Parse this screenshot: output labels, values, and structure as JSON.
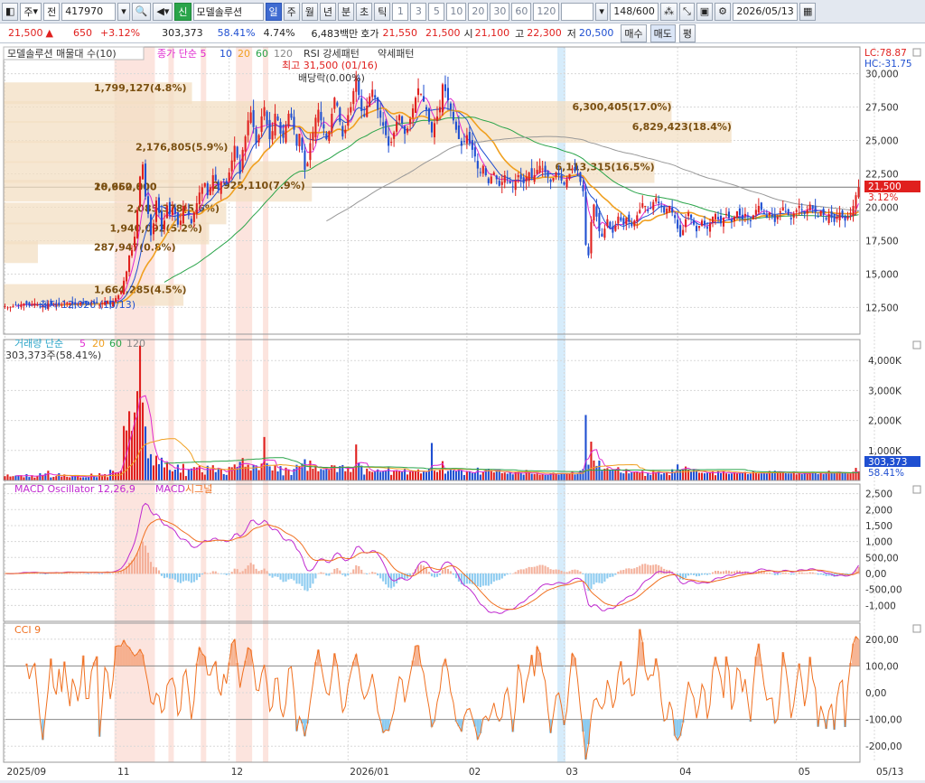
{
  "toolbar": {
    "market": "주",
    "prev": "전",
    "code": "417970",
    "badge": "신",
    "name": "모델솔루션",
    "period_tabs": [
      "일",
      "주",
      "월",
      "년",
      "분",
      "초",
      "틱"
    ],
    "active_tab": "일",
    "intervals": [
      "1",
      "3",
      "5",
      "10",
      "20",
      "30",
      "60",
      "120"
    ],
    "count": "148/600",
    "date": "2026/05/13"
  },
  "info": {
    "price": "21,500",
    "change": "650",
    "change_pct": "+3.12%",
    "volume": "303,373",
    "vol_ratio": "58.41%",
    "turnover": "4.74%",
    "amount": "6,483백만",
    "quote_label": "호가",
    "ask": "21,550",
    "bid": "21,500",
    "open_label": "시",
    "open": "21,100",
    "high_label": "고",
    "high": "22,300",
    "low_label": "저",
    "low": "20,500",
    "buy_btn": "매수",
    "sell_btn": "매도",
    "flat_btn": "평"
  },
  "chart_data": {
    "type": "candlestick",
    "price_panel": {
      "legend_name": "모델솔루션 매물대 수(10)",
      "legend_ma": [
        "종가 단순 5",
        "10",
        "20",
        "60",
        "120"
      ],
      "legend_rsi": "RSI 강세패턴",
      "legend_rsi2": "약세패턴",
      "lc": "LC:78.87",
      "hc": "HC:-31.75",
      "y_ticks": [
        "30,000",
        "27,500",
        "25,000",
        "22,500",
        "20,000",
        "17,500",
        "15,000",
        "12,500"
      ],
      "y_values": [
        30000,
        27500,
        25000,
        22500,
        20000,
        17500,
        15000,
        12500
      ],
      "ylim": [
        10500,
        32000
      ],
      "current": "21,500",
      "current_pct": "3.12%",
      "high_note": "최고 31,500 (01/16)",
      "low_note": "최저 12,020 (10/13)",
      "dividend_note": "배당락(0.00%)",
      "volume_profile": [
        {
          "label": "1,799,127(4.8%)",
          "p": 28400,
          "w": 0.22
        },
        {
          "label": "6,300,405(17.0%)",
          "p": 27000,
          "w": 0.78
        },
        {
          "label": "6,829,423(18.4%)",
          "p": 25500,
          "w": 0.85
        },
        {
          "label": "2,176,805(5.9%)",
          "p": 24000,
          "w": 0.27
        },
        {
          "label": "6,113,315(16.5%)",
          "p": 22500,
          "w": 0.76
        },
        {
          "label": "2,925,110(7.9%)",
          "p": 21100,
          "w": 0.36
        },
        {
          "label": "20,660,000",
          "p": 21000,
          "w": 0.0
        },
        {
          "label": "18,952,800",
          "p": 21000,
          "w": 0.0
        },
        {
          "label": "2,085,378(5.6%)",
          "p": 19400,
          "w": 0.26
        },
        {
          "label": "1,940,092(5.2%)",
          "p": 17900,
          "w": 0.24
        },
        {
          "label": "287,947(0.8%)",
          "p": 16500,
          "w": 0.04
        },
        {
          "label": "1,664,285(4.5%)",
          "p": 13300,
          "w": 0.21
        }
      ]
    },
    "volume_panel": {
      "legend": "거래량 단순",
      "legend_ma": [
        "5",
        "20",
        "60",
        "120"
      ],
      "sub": "303,373주(58.41%)",
      "y_ticks": [
        "4,000K",
        "3,000K",
        "2,000K",
        "1,000K"
      ],
      "y_values": [
        4000,
        3000,
        2000,
        1000
      ],
      "ylim": [
        0,
        4700
      ],
      "current": "303,373",
      "current_pct": "58.41%"
    },
    "macd_panel": {
      "legend": "MACD Oscillator 12,26,9",
      "legend2": "MACD",
      "legend3": "시그널",
      "y_ticks": [
        "2,500",
        "2,000",
        "1,500",
        "1,000",
        "500,00",
        "0,00",
        "-500,00",
        "-1,000"
      ],
      "y_values": [
        2500,
        2000,
        1500,
        1000,
        500,
        0,
        -500,
        -1000
      ],
      "ylim": [
        -1500,
        2800
      ]
    },
    "cci_panel": {
      "legend": "CCI 9",
      "y_ticks": [
        "200,00",
        "100,00",
        "0,00",
        "-100,00",
        "-200,00"
      ],
      "y_values": [
        200,
        100,
        0,
        -100,
        -200
      ],
      "ylim": [
        -260,
        260
      ]
    },
    "x_labels": [
      {
        "t": "2025/09",
        "i": 0
      },
      {
        "t": "11",
        "i": 41
      },
      {
        "t": "12",
        "i": 83
      },
      {
        "t": "2026/01",
        "i": 127
      },
      {
        "t": "02",
        "i": 171
      },
      {
        "t": "03",
        "i": 207
      },
      {
        "t": "04",
        "i": 249
      },
      {
        "t": "05",
        "i": 293
      },
      {
        "t": "05/13",
        "i": 320
      }
    ],
    "highlight_bands": [
      [
        41,
        55
      ],
      [
        61,
        62
      ],
      [
        73,
        74
      ],
      [
        86,
        91
      ],
      [
        96,
        97
      ]
    ],
    "blue_band": [
      205,
      207
    ],
    "closes": [
      12600,
      12500,
      12550,
      12600,
      12700,
      12650,
      12750,
      12800,
      12700,
      12650,
      12750,
      12800,
      12700,
      12550,
      12650,
      12500,
      12800,
      12750,
      12700,
      12800,
      12650,
      12700,
      12900,
      12850,
      12800,
      12750,
      12700,
      12800,
      12850,
      12800,
      12750,
      12700,
      12900,
      12800,
      12850,
      12700,
      12800,
      12950,
      13000,
      12700,
      13000,
      13200,
      13400,
      13700,
      14500,
      15200,
      16400,
      16800,
      17800,
      19800,
      22300,
      23200,
      20800,
      19500,
      17900,
      18800,
      20500,
      19600,
      18300,
      19000,
      20100,
      19500,
      20000,
      19500,
      18700,
      19000,
      20100,
      20000,
      19400,
      18800,
      19600,
      20300,
      21100,
      21500,
      21800,
      20900,
      21500,
      22400,
      22000,
      21300,
      21900,
      22100,
      21800,
      22600,
      23500,
      24600,
      23700,
      22500,
      24300,
      25300,
      26500,
      27100,
      26000,
      24800,
      25400,
      26800,
      27500,
      26200,
      25100,
      25700,
      27000,
      26500,
      25500,
      25200,
      26100,
      27000,
      26700,
      25800,
      24600,
      25500,
      24300,
      22800,
      23300,
      24800,
      25600,
      26700,
      27300,
      26500,
      25900,
      25100,
      25700,
      27000,
      28200,
      27600,
      26400,
      25300,
      25800,
      26900,
      27500,
      28700,
      29800,
      28400,
      27200,
      26800,
      27600,
      28300,
      28800,
      28200,
      27300,
      26700,
      26100,
      25400,
      24600,
      24900,
      25600,
      26400,
      26900,
      26300,
      25500,
      25900,
      26600,
      27400,
      28200,
      28900,
      28500,
      27900,
      27300,
      26400,
      25600,
      26300,
      26800,
      27500,
      29200,
      28700,
      28000,
      27300,
      26500,
      25800,
      25100,
      24600,
      24900,
      25400,
      24800,
      24300,
      23800,
      22900,
      22600,
      23100,
      22400,
      21800,
      22300,
      22600,
      22100,
      21600,
      21900,
      22400,
      22100,
      21800,
      21500,
      22000,
      22400,
      22100,
      21800,
      22300,
      22600,
      22200,
      22400,
      22800,
      23100,
      22900,
      22600,
      22300,
      21900,
      22200,
      22600,
      22400,
      22000,
      21700,
      22100,
      22500,
      22900,
      22700,
      22400,
      21900,
      21200,
      17200,
      16400,
      18900,
      20200,
      19300,
      18200,
      17800,
      18400,
      19100,
      18500,
      18100,
      18600,
      19300,
      19000,
      18700,
      19200,
      18900,
      18600,
      19000,
      19400,
      19800,
      20300,
      20100,
      19700,
      19900,
      20400,
      20700,
      20300,
      20000,
      19600,
      19900,
      20100,
      19600,
      19200,
      18400,
      17800,
      18300,
      19100,
      19600,
      19200,
      18700,
      18200,
      18600,
      19000,
      18700,
      18400,
      18800,
      19300,
      19500,
      19100,
      18800,
      19200,
      19500,
      19200,
      18900,
      19300,
      19700,
      19400,
      19100,
      19500,
      19300,
      19000,
      19400,
      19800,
      20100,
      19800,
      19500,
      19200,
      19600,
      19300,
      18900,
      19300,
      19700,
      20000,
      19700,
      19400,
      19100,
      19500,
      19800,
      20100,
      19800,
      19500,
      19800,
      20200,
      19900,
      19600,
      19300,
      19700,
      19400,
      19100,
      19500,
      19200,
      18900,
      19300,
      19600,
      19300,
      19000,
      19300,
      19600,
      20100,
      20900,
      21500
    ]
  }
}
